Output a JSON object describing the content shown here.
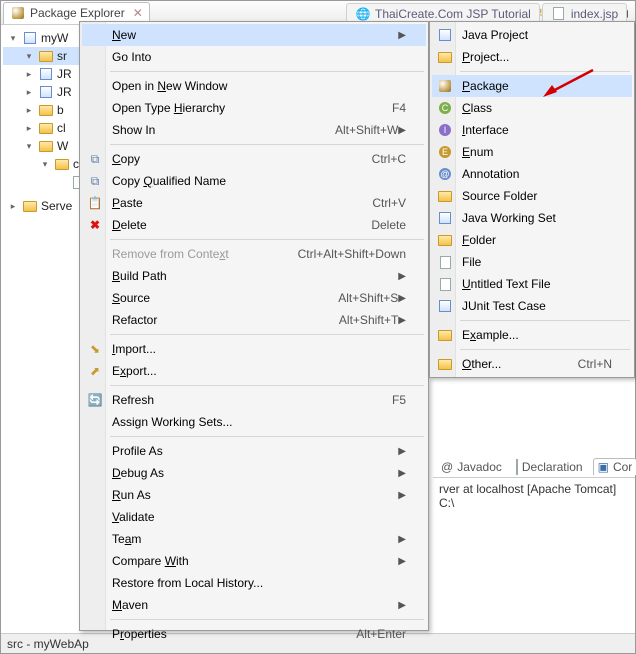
{
  "view": {
    "title": "Package Explorer"
  },
  "editor_tabs": [
    {
      "label": "ThaiCreate.Com JSP Tutorial"
    },
    {
      "label": "index.jsp"
    }
  ],
  "tree": {
    "project": "myW",
    "sel": "sr",
    "nodes": [
      "JR",
      "JR",
      "b",
      "cl",
      "W",
      "c"
    ],
    "servers": "Serve"
  },
  "status": "src - myWebAp",
  "bottom": {
    "tabs": [
      {
        "label": "Javadoc"
      },
      {
        "label": "Declaration"
      },
      {
        "label": "Cor"
      }
    ],
    "content": "rver at localhost [Apache Tomcat] C:\\"
  },
  "menu": [
    {
      "label": "New",
      "mn": "N",
      "submenu": true,
      "hover": true
    },
    {
      "label": "Go Into"
    },
    {
      "sep": true
    },
    {
      "label": "Open in New Window",
      "mn": "N"
    },
    {
      "label": "Open Type Hierarchy",
      "mn": "H",
      "accel": "F4"
    },
    {
      "label": "Show In",
      "mn": "W",
      "accel": "Alt+Shift+W",
      "submenu": true
    },
    {
      "sep": true
    },
    {
      "label": "Copy",
      "mn": "C",
      "accel": "Ctrl+C",
      "icon": "copy-icon"
    },
    {
      "label": "Copy Qualified Name",
      "mn": "Q",
      "icon": "copy-icon"
    },
    {
      "label": "Paste",
      "mn": "P",
      "accel": "Ctrl+V",
      "icon": "paste-icon"
    },
    {
      "label": "Delete",
      "mn": "D",
      "accel": "Delete",
      "icon": "delete-icon"
    },
    {
      "sep": true
    },
    {
      "label": "Remove from Context",
      "mn": "x",
      "accel": "Ctrl+Alt+Shift+Down",
      "disabled": true
    },
    {
      "label": "Build Path",
      "mn": "B",
      "submenu": true
    },
    {
      "label": "Source",
      "mn": "S",
      "accel": "Alt+Shift+S",
      "submenu": true
    },
    {
      "label": "Refactor",
      "mn": "T",
      "accel": "Alt+Shift+T",
      "submenu": true
    },
    {
      "sep": true
    },
    {
      "label": "Import...",
      "mn": "I",
      "icon": "import-icon"
    },
    {
      "label": "Export...",
      "mn": "x",
      "icon": "export-icon"
    },
    {
      "sep": true
    },
    {
      "label": "Refresh",
      "mn": "F",
      "accel": "F5",
      "icon": "refresh-icon"
    },
    {
      "label": "Assign Working Sets..."
    },
    {
      "sep": true
    },
    {
      "label": "Profile As",
      "submenu": true
    },
    {
      "label": "Debug As",
      "mn": "D",
      "submenu": true
    },
    {
      "label": "Run As",
      "mn": "R",
      "submenu": true
    },
    {
      "label": "Validate",
      "mn": "V"
    },
    {
      "label": "Team",
      "mn": "a",
      "submenu": true
    },
    {
      "label": "Compare With",
      "mn": "W",
      "submenu": true
    },
    {
      "label": "Restore from Local History..."
    },
    {
      "label": "Maven",
      "mn": "M",
      "submenu": true
    },
    {
      "sep": true
    },
    {
      "label": "Properties",
      "mn": "r",
      "accel": "Alt+Enter"
    }
  ],
  "submenu": [
    {
      "label": "Java Project",
      "icon": "java-project-icon"
    },
    {
      "label": "Project...",
      "mn": "P",
      "icon": "project-icon"
    },
    {
      "sep": true
    },
    {
      "label": "Package",
      "mn": "P",
      "icon": "package-icon",
      "hover": true
    },
    {
      "label": "Class",
      "mn": "C",
      "icon": "class-icon"
    },
    {
      "label": "Interface",
      "mn": "I",
      "icon": "interface-icon"
    },
    {
      "label": "Enum",
      "mn": "E",
      "icon": "enum-icon"
    },
    {
      "label": "Annotation",
      "icon": "annotation-icon"
    },
    {
      "label": "Source Folder",
      "icon": "source-folder-icon"
    },
    {
      "label": "Java Working Set",
      "icon": "working-set-icon"
    },
    {
      "label": "Folder",
      "mn": "F",
      "icon": "folder-icon"
    },
    {
      "label": "File",
      "icon": "file-icon"
    },
    {
      "label": "Untitled Text File",
      "mn": "U",
      "icon": "text-file-icon"
    },
    {
      "label": "JUnit Test Case",
      "icon": "junit-icon"
    },
    {
      "sep": true
    },
    {
      "label": "Example...",
      "mn": "x",
      "icon": "example-icon"
    },
    {
      "sep": true
    },
    {
      "label": "Other...",
      "mn": "O",
      "accel": "Ctrl+N",
      "icon": "other-icon"
    }
  ]
}
